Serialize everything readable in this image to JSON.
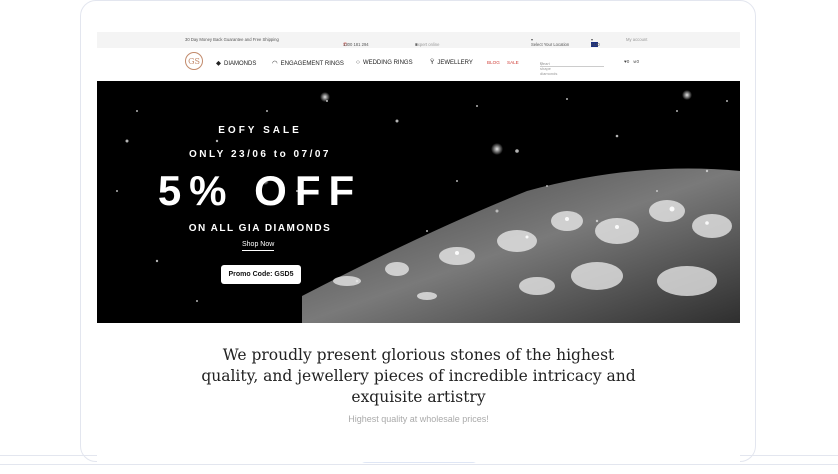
{
  "topbar": {
    "guarantee": "30 Day Money Back Guarantee and Free Shipping",
    "phone": "1300 181 294",
    "expert": "Expert online",
    "location": "Select Your Location",
    "currency": "AUD",
    "account": "My account"
  },
  "nav": {
    "logo": "GS",
    "items": [
      {
        "label": "DIAMONDS",
        "icon": "diamond-icon"
      },
      {
        "label": "ENGAGEMENT RINGS",
        "icon": "ring-icon"
      },
      {
        "label": "WEDDING RINGS",
        "icon": "ring-outline-icon"
      },
      {
        "label": "JEWELLERY",
        "icon": "pendant-icon"
      }
    ],
    "blog": "BLOG",
    "sale": "SALE",
    "search_placeholder": "Heart shape diamonds",
    "wishlist_count": "0",
    "cart_count": "0"
  },
  "hero": {
    "line1": "EOFY SALE",
    "line2": "ONLY 23/06 to 07/07",
    "line3": "5% OFF",
    "line4": "ON ALL GIA DIAMONDS",
    "shop_now": "Shop Now",
    "promo": "Promo Code: GSD5"
  },
  "intro": {
    "line1": "We proudly present glorious stones of the highest",
    "line2": "quality, and jewellery pieces of incredible intricacy and",
    "line3": "exquisite artistry",
    "tagline": "Highest quality at wholesale prices!"
  },
  "colors": {
    "accent": "#d0413a",
    "logo": "#c28a6b",
    "hero_bg": "#000000"
  }
}
